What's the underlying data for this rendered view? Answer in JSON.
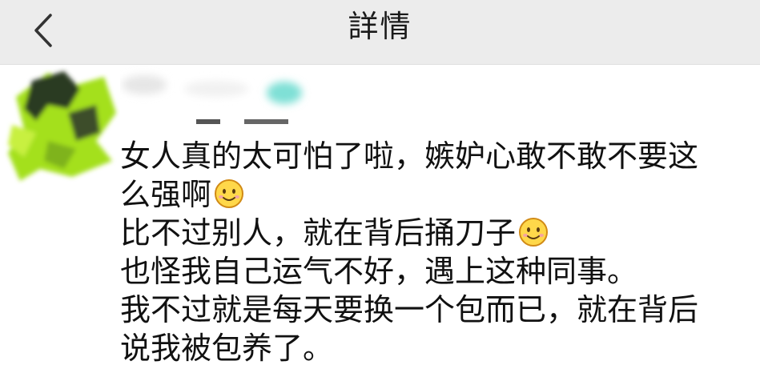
{
  "nav": {
    "title": "詳情",
    "back_icon": "chevron-left-icon"
  },
  "post": {
    "lines": [
      {
        "text": "女人真的太可怕了啦，嫉妒心敢不敢不要这",
        "emoji": false
      },
      {
        "text": "么强啊",
        "emoji": true
      },
      {
        "text": "比不过别人，就在背后捅刀子",
        "emoji": true
      },
      {
        "text": "也怪我自己运气不好，遇上这种同事。",
        "emoji": false
      },
      {
        "text": "我不过就是每天要换一个包而已，就在背后",
        "emoji": false
      },
      {
        "text": "说我被包养了。",
        "emoji": false
      }
    ],
    "emoji_icon": "smiley-emoji-icon"
  },
  "colors": {
    "nav_background": "#ececec",
    "text": "#111111",
    "avatar_green": "#a4e01e",
    "avatar_dark": "#2b3a22",
    "name_teal": "#7fe0d6"
  }
}
